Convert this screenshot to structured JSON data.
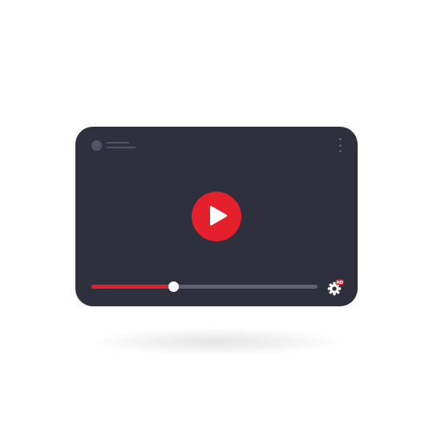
{
  "player": {
    "progress_fraction": 0.36,
    "hd_badge": "HD",
    "icons": {
      "play": "play-icon",
      "settings": "gear-icon",
      "more": "more-vertical-icon"
    },
    "colors": {
      "background": "#2e303e",
      "accent": "#e4202c",
      "track": "#5f6170",
      "muted": "#505363",
      "thumb": "#ffffff"
    }
  }
}
